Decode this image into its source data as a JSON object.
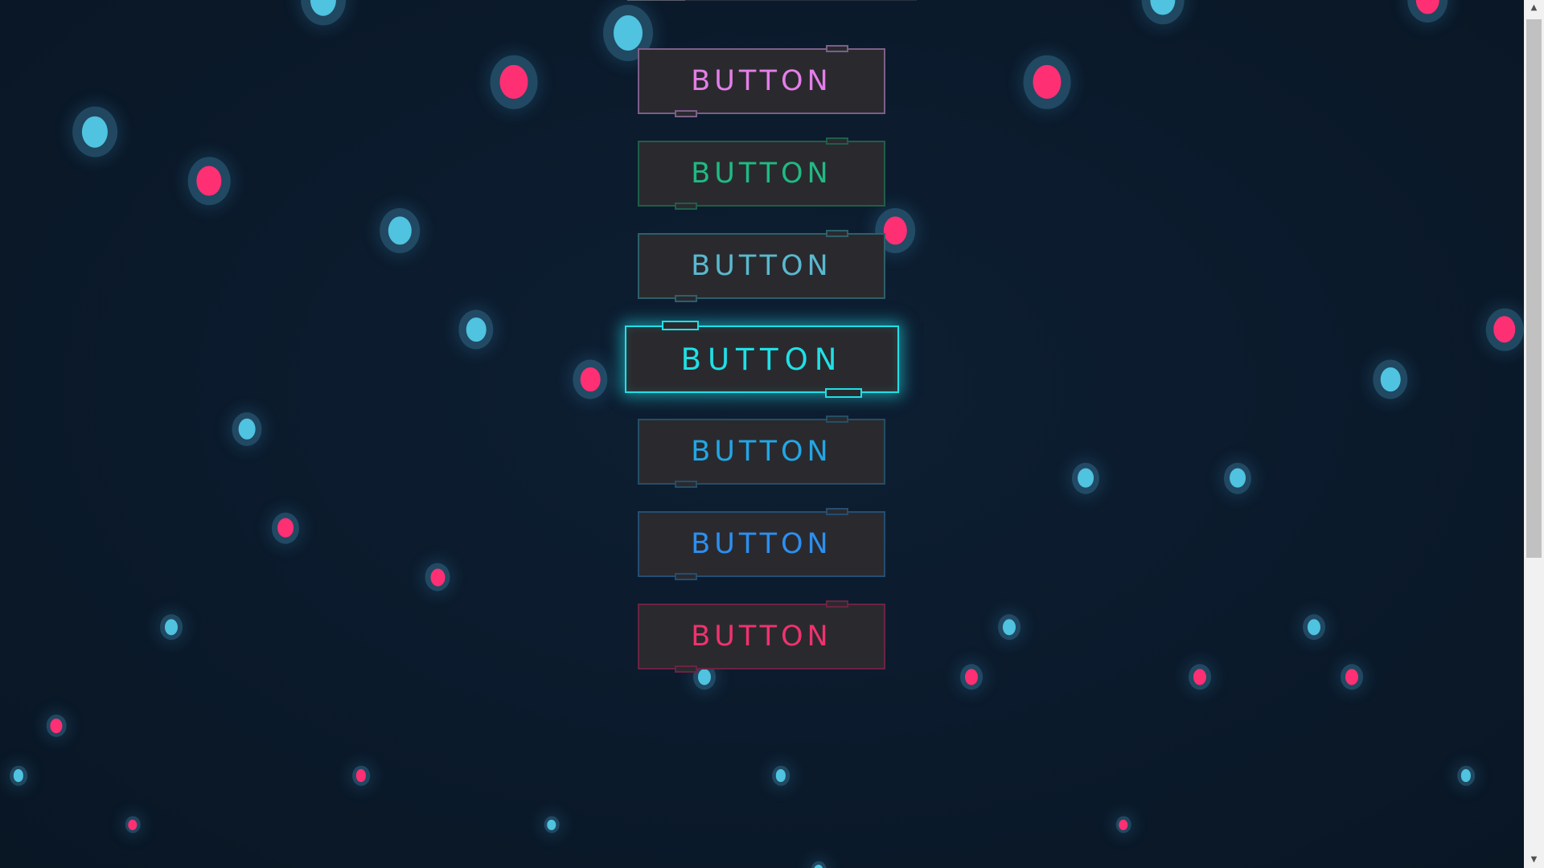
{
  "buttons": [
    {
      "label": "BUTTON",
      "color": "#e47ee8",
      "border": "#7b5f88",
      "state": "default"
    },
    {
      "label": "BUTTON",
      "color": "#1fba83",
      "border": "#1f5e4a",
      "state": "default"
    },
    {
      "label": "BUTTON",
      "color": "#5ab8cf",
      "border": "#2d5f6b",
      "state": "default"
    },
    {
      "label": "BUTTON",
      "color": "#1fe0e6",
      "border": "#1fe0e6",
      "state": "active"
    },
    {
      "label": "BUTTON",
      "color": "#22a6e6",
      "border": "#244e66",
      "state": "default"
    },
    {
      "label": "BUTTON",
      "color": "#2c8ff0",
      "border": "#254d70",
      "state": "default"
    },
    {
      "label": "BUTTON",
      "color": "#f0326e",
      "border": "#6b2342",
      "state": "default"
    }
  ],
  "particles": {
    "colors": {
      "cyan": "#4fc3e0",
      "pink": "#ff2f74",
      "halo": "#2f6f8f"
    }
  },
  "scrollbar": {
    "up_icon": "scroll-up-arrow-icon",
    "down_icon": "scroll-down-arrow-icon"
  }
}
